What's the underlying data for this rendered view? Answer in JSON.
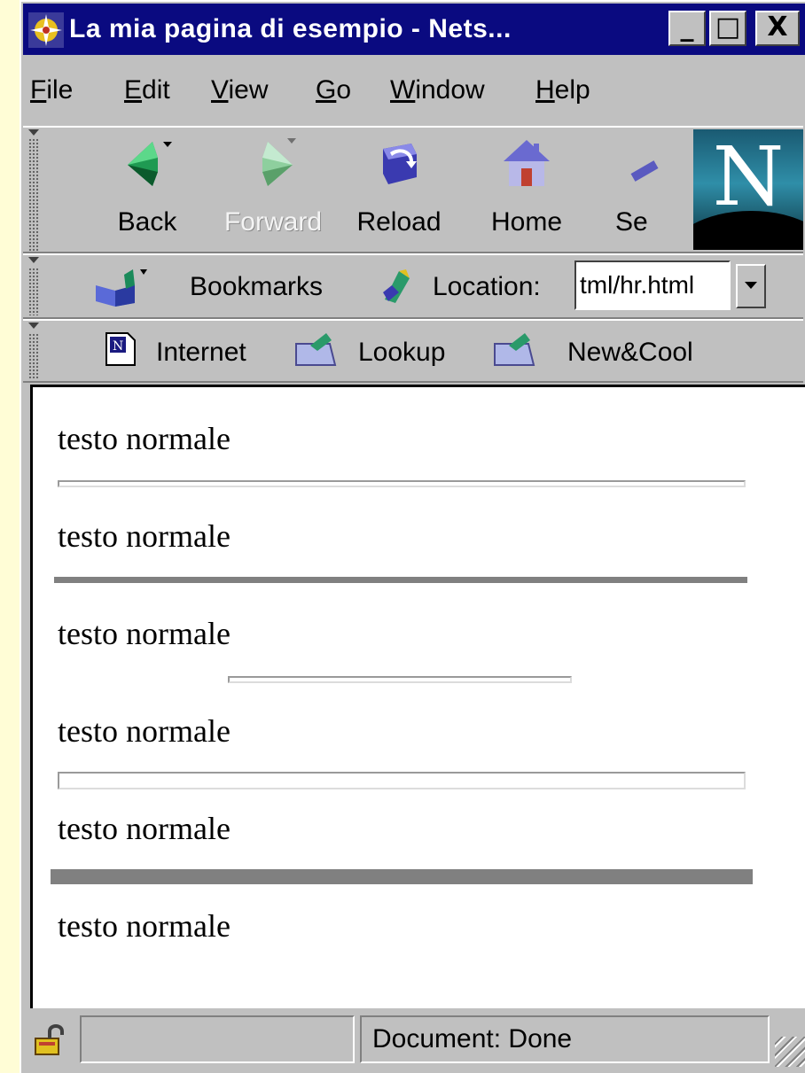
{
  "window": {
    "title": "La mia pagina di esempio - Nets...",
    "controls": {
      "minimize": "_",
      "maximize": "□",
      "close": "X"
    }
  },
  "menu": [
    {
      "label": "File",
      "mnemonic": "F",
      "rest": "ile"
    },
    {
      "label": "Edit",
      "mnemonic": "E",
      "rest": "dit"
    },
    {
      "label": "View",
      "mnemonic": "V",
      "rest": "iew"
    },
    {
      "label": "Go",
      "mnemonic": "G",
      "rest": "o"
    },
    {
      "label": "Window",
      "mnemonic": "W",
      "rest": "indow"
    },
    {
      "label": "Help",
      "mnemonic": "H",
      "rest": "elp"
    }
  ],
  "navigation": {
    "back": "Back",
    "forward": "Forward",
    "reload": "Reload",
    "home": "Home",
    "search": "Se"
  },
  "location_bar": {
    "bookmarks_label": "Bookmarks",
    "location_label": "Location:",
    "url": "tml/hr.html"
  },
  "personal_toolbar": {
    "internet": "Internet",
    "lookup": "Lookup",
    "newcool": "New&Cool"
  },
  "page": {
    "paragraphs": [
      "testo normale",
      "testo normale",
      "testo normale",
      "testo normale",
      "testo normale",
      "testo normale"
    ]
  },
  "status": {
    "text": "Document: Done"
  },
  "colors": {
    "titlebar": "#0a0a80",
    "chrome": "#c0c0c0",
    "page_background": "#ffffff",
    "rule_gray": "#808080"
  }
}
